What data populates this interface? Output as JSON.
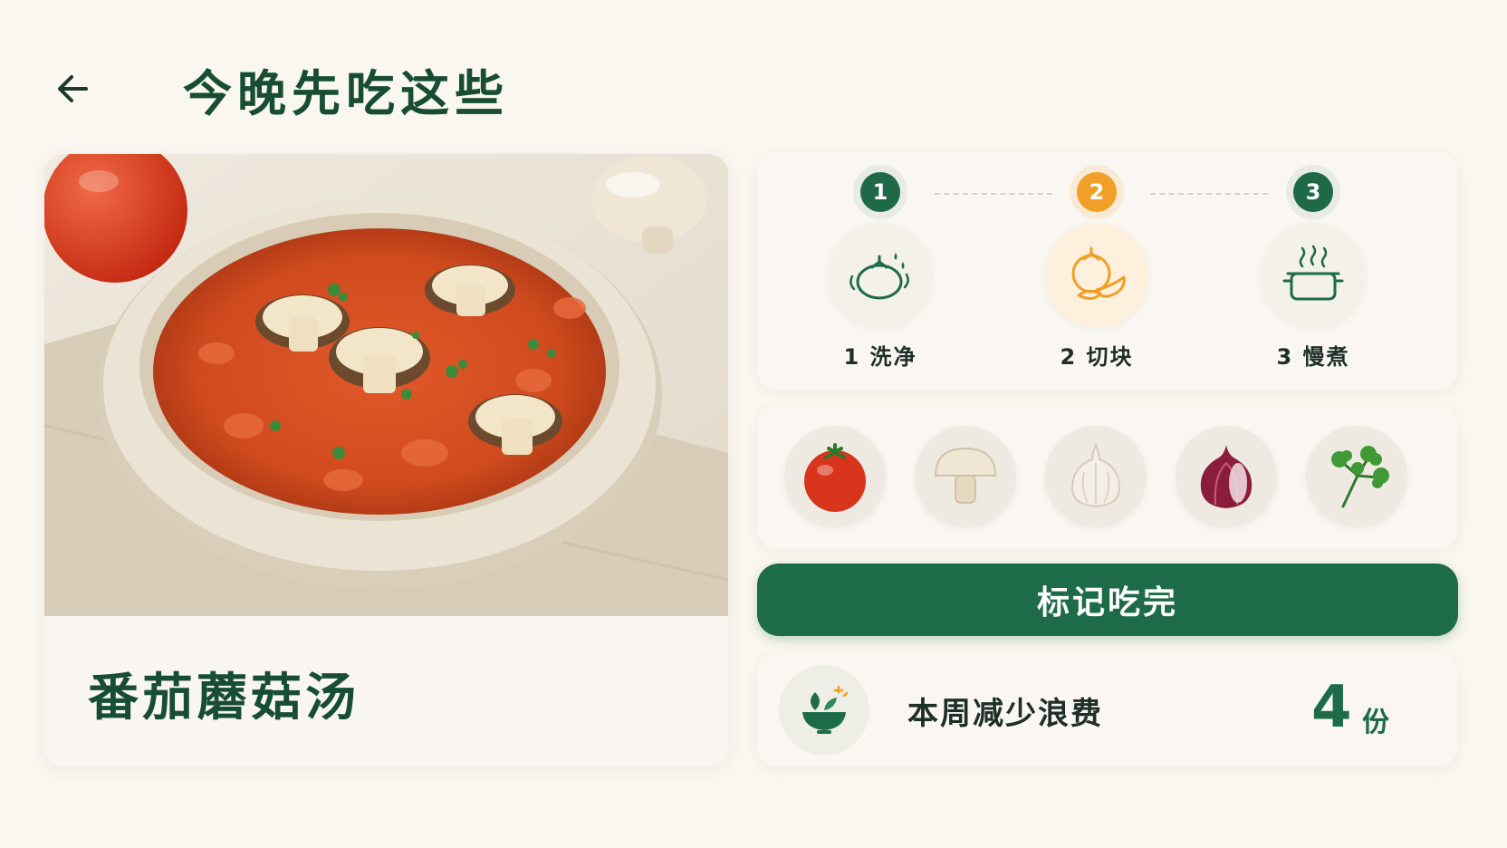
{
  "header": {
    "back_icon": "arrow-left-icon",
    "title": "今晚先吃这些"
  },
  "dish": {
    "name": "番茄蘑菇汤",
    "photo": "tomato-mushroom-soup-bowl"
  },
  "steps": [
    {
      "number": "1",
      "label": "1 洗净",
      "icon": "wash-tomato-icon",
      "active": false
    },
    {
      "number": "2",
      "label": "2 切块",
      "icon": "chopped-tomato-icon",
      "active": true
    },
    {
      "number": "3",
      "label": "3 慢煮",
      "icon": "simmering-pot-icon",
      "active": false
    }
  ],
  "ingredients": [
    {
      "name": "tomato",
      "icon": "tomato-icon"
    },
    {
      "name": "mushroom",
      "icon": "mushroom-icon"
    },
    {
      "name": "garlic",
      "icon": "garlic-icon"
    },
    {
      "name": "red-onion",
      "icon": "red-onion-icon"
    },
    {
      "name": "parsley",
      "icon": "parsley-icon"
    }
  ],
  "actions": {
    "mark_done_label": "标记吃完"
  },
  "stats": {
    "icon": "bowl-leaf-icon",
    "label": "本周减少浪费",
    "value": "4",
    "unit": "份"
  },
  "colors": {
    "primary": "#1d6b48",
    "accent": "#f0a028",
    "background": "#faf6f0"
  }
}
